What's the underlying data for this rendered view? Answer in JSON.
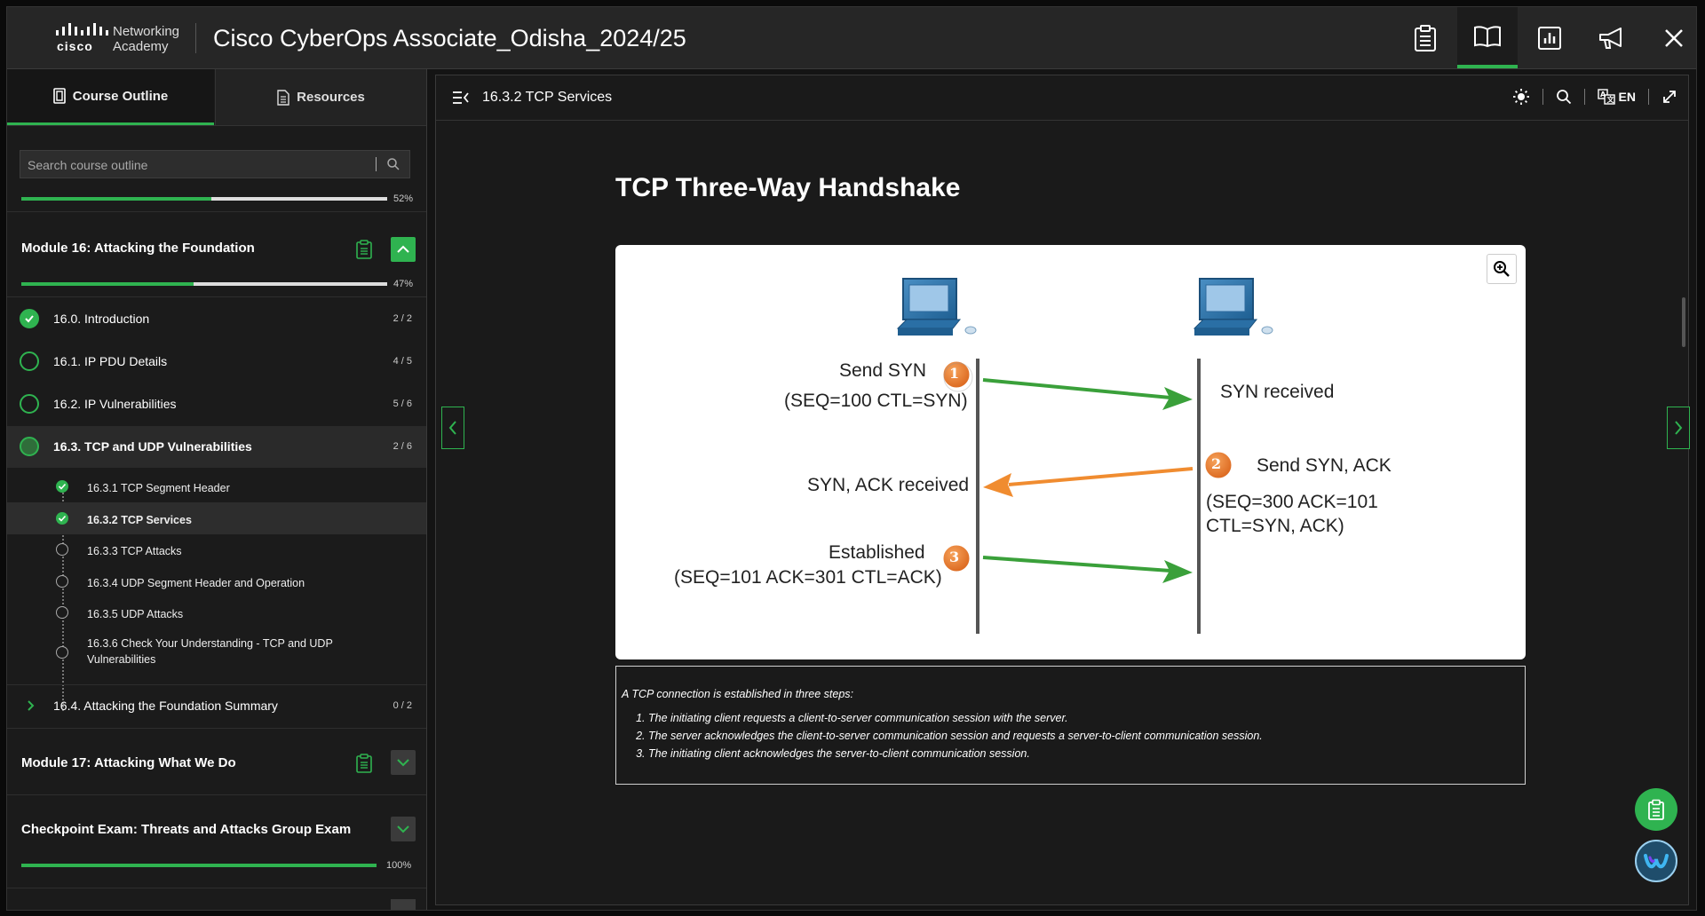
{
  "app": {
    "logo_line1": "Networking",
    "logo_line2": "Academy",
    "logo_brand": "cisco",
    "title": "Cisco CyberOps Associate_Odisha_2024/25"
  },
  "toolbar": {
    "buttons": [
      "clipboard-icon",
      "book-icon",
      "chart-icon",
      "megaphone-icon",
      "close-icon"
    ],
    "active": "book-icon"
  },
  "sidebar": {
    "tabs": [
      {
        "label": "Course Outline",
        "icon": "outline-icon",
        "active": true
      },
      {
        "label": "Resources",
        "icon": "document-icon",
        "active": false
      }
    ],
    "search_placeholder": "Search course outline",
    "top_progress_pct": "52%",
    "top_progress_value": 0.52,
    "modules": [
      {
        "title": "Module 16: Attacking the Foundation",
        "progress_pct": "47%",
        "progress_value": 0.47,
        "expanded": true,
        "sections": [
          {
            "label": "16.0. Introduction",
            "count": "2 / 2",
            "state": "done"
          },
          {
            "label": "16.1. IP PDU Details",
            "count": "4 / 5",
            "state": "partial"
          },
          {
            "label": "16.2. IP Vulnerabilities",
            "count": "5 / 6",
            "state": "partial"
          },
          {
            "label": "16.3. TCP and UDP Vulnerabilities",
            "count": "2 / 6",
            "state": "current"
          },
          {
            "label": "16.4. Attacking the Foundation Summary",
            "count": "0 / 2",
            "state": "collapsed"
          }
        ],
        "subsections": [
          {
            "label": "16.3.1 TCP Segment Header",
            "state": "done"
          },
          {
            "label": "16.3.2 TCP Services",
            "state": "done",
            "selected": true
          },
          {
            "label": "16.3.3 TCP Attacks",
            "state": "empty"
          },
          {
            "label": "16.3.4 UDP Segment Header and Operation",
            "state": "empty"
          },
          {
            "label": "16.3.5 UDP Attacks",
            "state": "empty"
          },
          {
            "label": "16.3.6 Check Your Understanding - TCP and UDP Vulnerabilities",
            "state": "empty"
          }
        ]
      },
      {
        "title": "Module 17: Attacking What We Do",
        "expanded": false
      },
      {
        "title": "Checkpoint Exam: Threats and Attacks Group Exam",
        "progress_pct": "100%",
        "progress_value": 1.0,
        "expanded": false
      }
    ]
  },
  "content": {
    "breadcrumb": "16.3.2 TCP Services",
    "language": "EN",
    "heading": "TCP Three-Way Handshake",
    "diagram": {
      "step1_label": "Send SYN",
      "step1_detail": "(SEQ=100 CTL=SYN)",
      "step1_received": "SYN received",
      "step2_label": "Send SYN, ACK",
      "step2_detail_line1": "(SEQ=300 ACK=101",
      "step2_detail_line2": "CTL=SYN, ACK)",
      "step2_received": "SYN, ACK received",
      "step3_label": "Established",
      "step3_detail": "(SEQ=101 ACK=301 CTL=ACK)",
      "badges": [
        "1",
        "2",
        "3"
      ],
      "arrow_green": "#3aa03a",
      "arrow_orange": "#f08c30",
      "badge_orange": "#e8761e"
    },
    "caption": {
      "intro": "A TCP connection is established in three steps:",
      "steps": [
        "The initiating client requests a client-to-server communication session with the server.",
        "The server acknowledges the client-to-server communication session and requests a server-to-client communication session.",
        "The initiating client acknowledges the server-to-client communication session."
      ]
    }
  },
  "colors": {
    "accent": "#2fb350",
    "background": "#141414"
  }
}
